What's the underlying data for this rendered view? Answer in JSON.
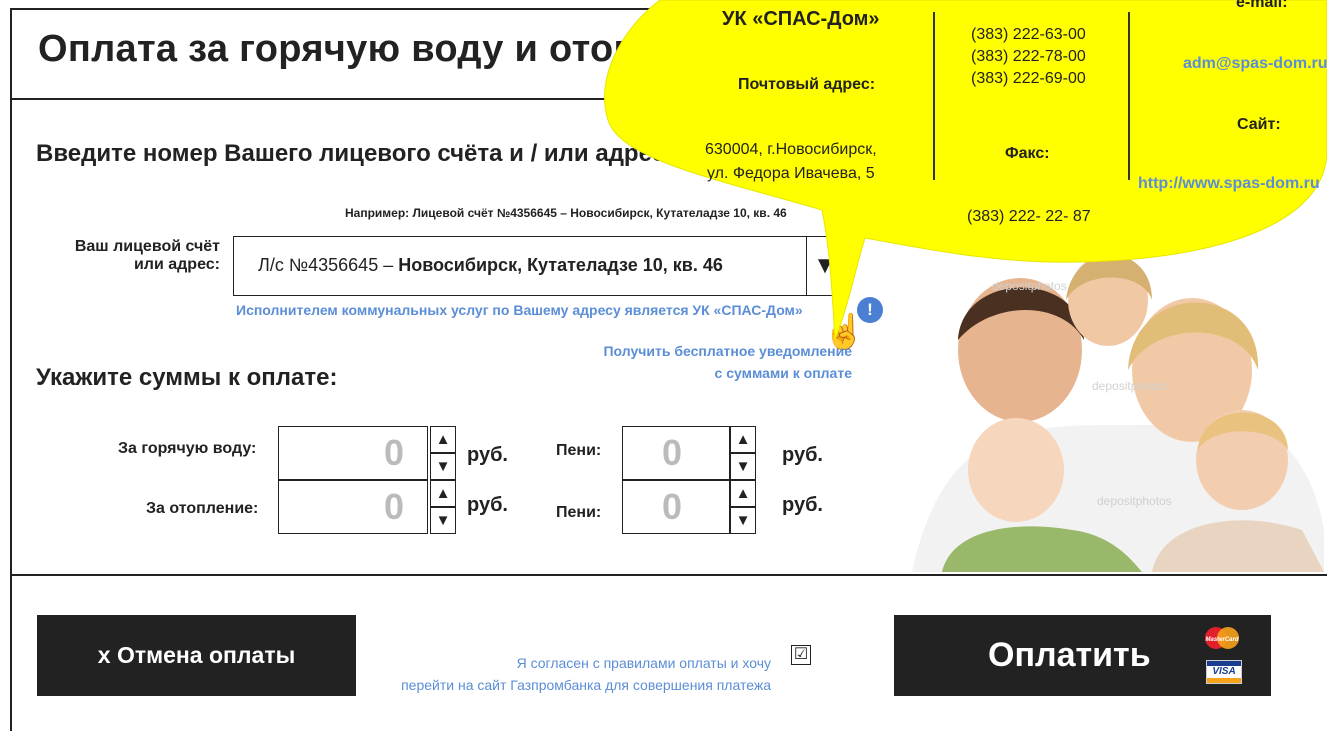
{
  "page": {
    "title": "Оплата за горячую воду и отопление",
    "account_prompt": "Введите номер Вашего лицевого счёта и / или адрес:",
    "example": "Например: Лицевой счёт №4356645 – Новосибирск, Кутателадзе 10, кв. 46"
  },
  "account": {
    "label_line1": "Ваш лицевой счёт",
    "label_line2": "или адрес:",
    "value_prefix": "Л/с №4356645 – ",
    "value_bold": "Новосибирск, Кутателадзе 10, кв. 46",
    "dropdown_glyph": "▼",
    "provider_note": "Исполнителем коммунальных услуг по Вашему адресу является УК «СПАС-Дом»"
  },
  "amounts": {
    "heading": "Укажите суммы к оплате:",
    "notify_line1": "Получить бесплатное уведомление",
    "notify_line2": "с суммами к оплате",
    "hot_water_label": "За горячую воду:",
    "heating_label": "За отопление:",
    "penalty_label": "Пени:",
    "hot_water_value": "0",
    "hot_water_penalty_value": "0",
    "heating_value": "0",
    "heating_penalty_value": "0",
    "currency": "руб.",
    "up": "▲",
    "down": "▼"
  },
  "footer": {
    "cancel_label": "x  Отмена оплаты",
    "consent_line1": "Я согласен  с правилами оплаты и хочу",
    "consent_line2": "перейти на сайт Газпромбанка для совершения платежа",
    "consent_checked": "☑",
    "pay_label": "Оплатить",
    "card_mastercard": "MasterCard",
    "card_visa": "VISA"
  },
  "bubble": {
    "company": "УК «СПАС-Дом»",
    "postal_label": "Почтовый адрес:",
    "address_line1": "630004, г.Новосибирск,",
    "address_line2": "ул. Федора Ивачева, 5",
    "phone1": "(383) 222-63-00",
    "phone2": "(383) 222-78-00",
    "phone3": "(383) 222-69-00",
    "fax_label": "Факс:",
    "fax": "(383) 222- 22- 87",
    "email_label": "e-mail:",
    "email": "adm@spas-dom.ru",
    "site_label": "Сайт:",
    "site": "http://www.spas-dom.ru",
    "color": "#ffff00"
  },
  "photo": {
    "watermark": "depositphotos"
  },
  "colors": {
    "accent_link": "#5b8ed6",
    "dark_button": "#222222",
    "info_dot": "#4a7fd4"
  }
}
